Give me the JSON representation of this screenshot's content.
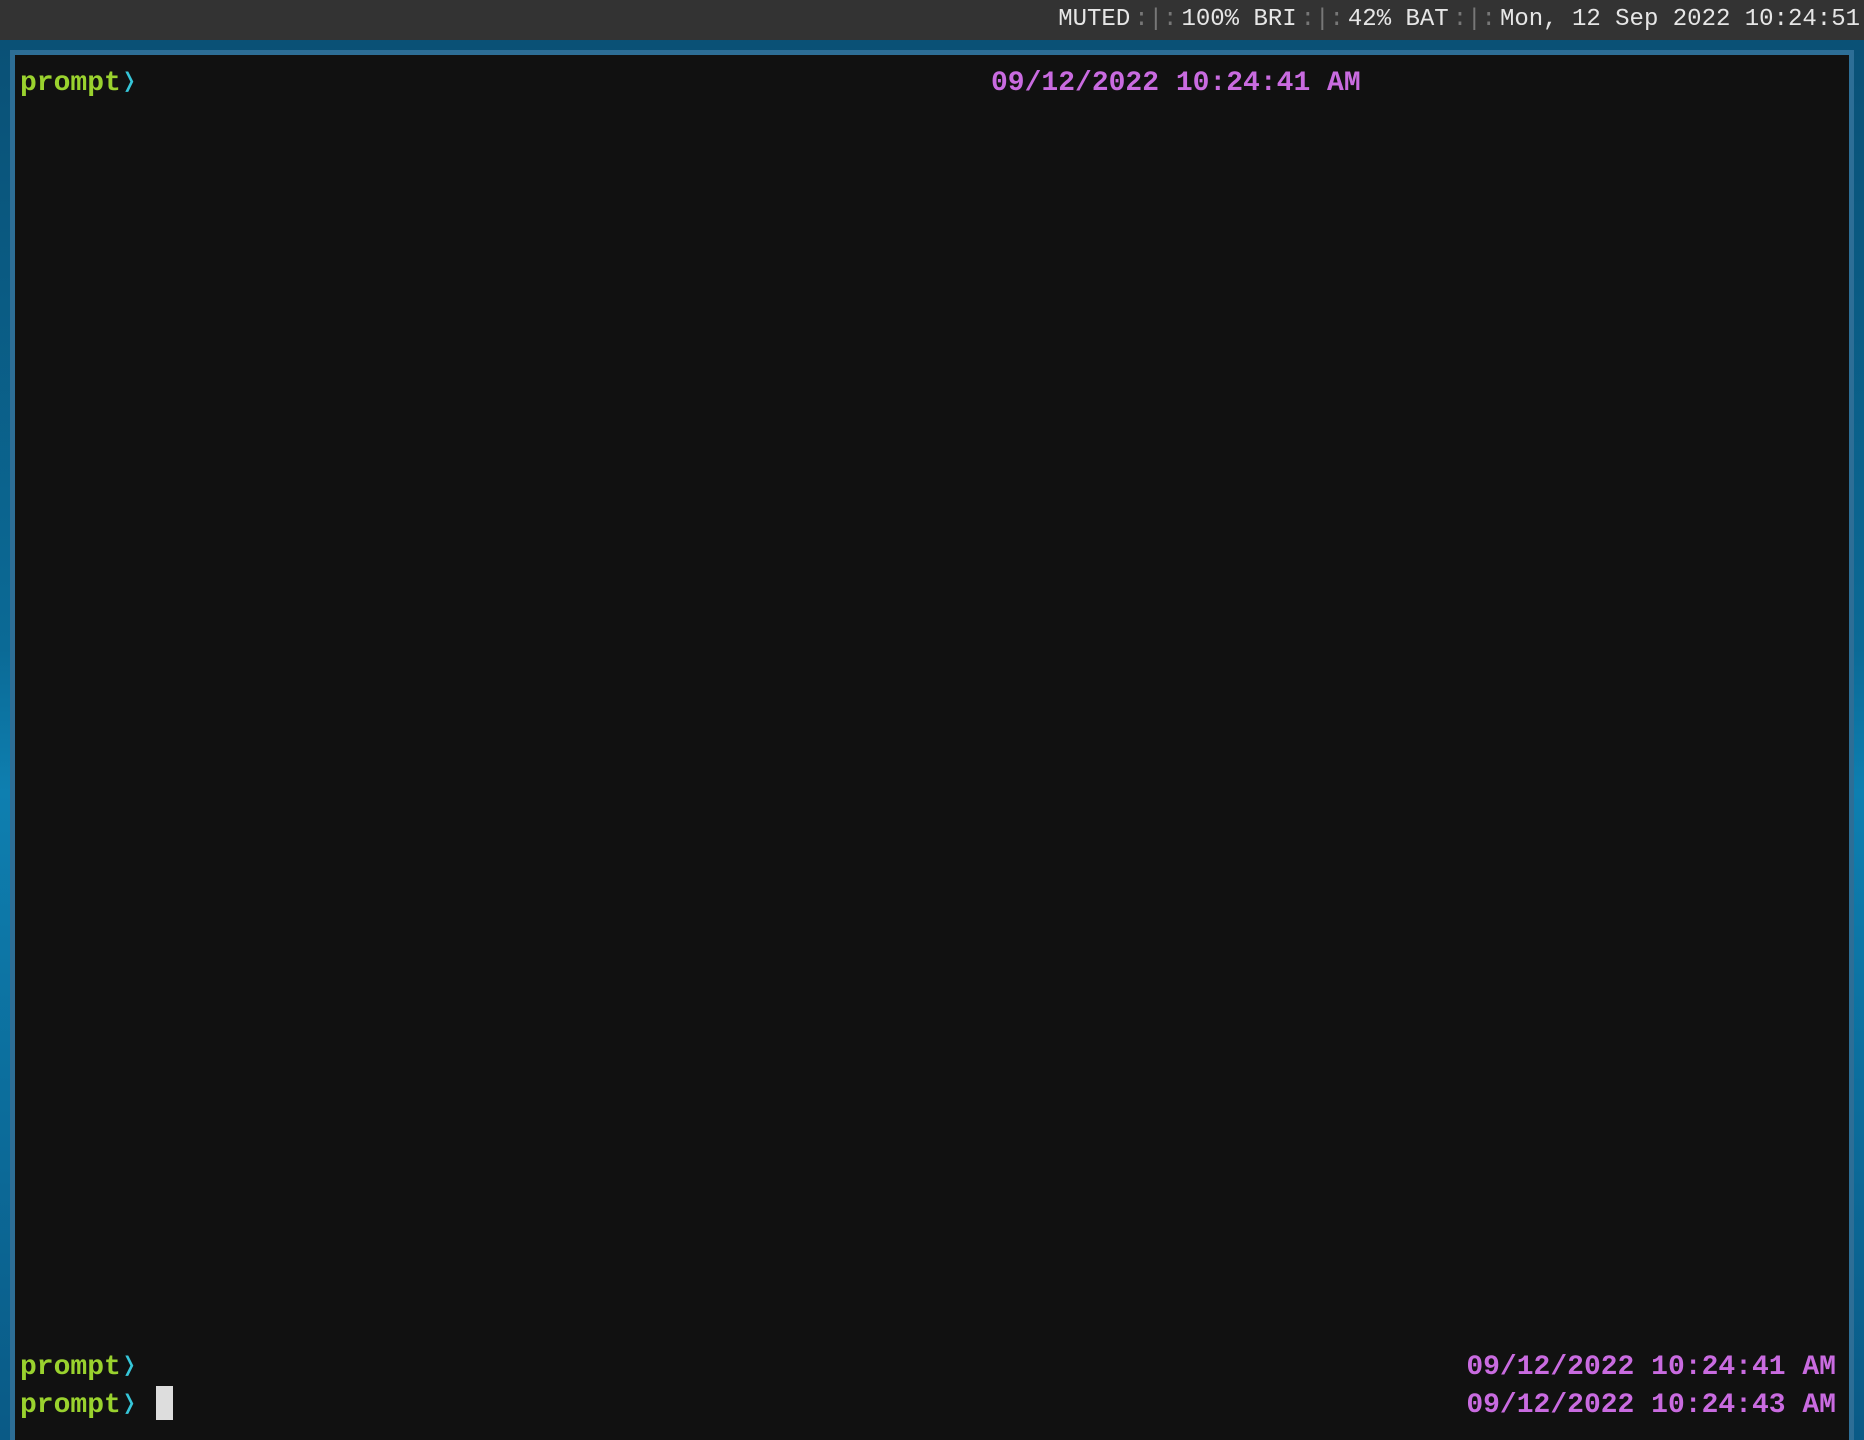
{
  "status_bar": {
    "items": [
      "MUTED",
      "100% BRI",
      "42% BAT",
      "Mon, 12 Sep 2022 10:24:51"
    ],
    "separator": ":|:"
  },
  "terminal": {
    "lines": [
      {
        "prompt": "prompt",
        "arrow": "❭",
        "timestamp": "09/12/2022 10:24:41 AM"
      },
      {
        "prompt": "prompt",
        "arrow": "❭",
        "timestamp": "09/12/2022 10:24:41 AM"
      },
      {
        "prompt": "prompt",
        "arrow": "❭",
        "timestamp": "09/12/2022 10:24:43 AM"
      }
    ]
  },
  "colors": {
    "prompt": "#9ad22e",
    "arrow": "#36c6d9",
    "timestamp": "#c96be0",
    "terminal_bg": "#111111",
    "border": "#2d6e96",
    "status_bg": "#333333"
  }
}
